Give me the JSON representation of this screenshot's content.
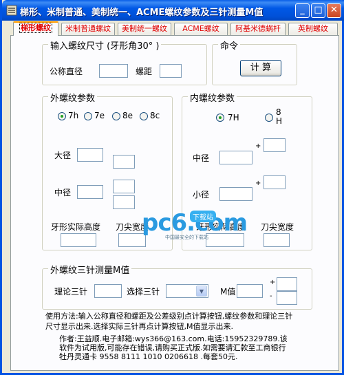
{
  "window": {
    "title": "梯形、米制普通、美制统一、ACME螺纹参数及三针测量M值",
    "minimize": "_",
    "maximize": "□",
    "close": "✕"
  },
  "tabs": [
    "梯形螺纹",
    "米制普通螺纹",
    "美制统一螺纹",
    "ACME螺纹",
    "阿基米德蜗杆",
    "英制螺纹"
  ],
  "input_group": {
    "legend": "输入螺纹尺寸 (牙形角30° )",
    "diameter_label": "公称直径",
    "pitch_label": "螺距"
  },
  "command_group": {
    "legend": "命令",
    "calc_label": "计 算"
  },
  "external": {
    "legend": "外螺纹参数",
    "options": [
      "7h",
      "7e",
      "8e",
      "8c"
    ],
    "selected": "7h",
    "major_label": "大径",
    "pitch_dia_label": "中径",
    "thread_height_label": "牙形实际高度",
    "tip_width_label": "刀尖宽度"
  },
  "internal": {
    "legend": "内螺纹参数",
    "options": [
      "7H",
      "8\nH"
    ],
    "selected": "7H",
    "pitch_dia_label": "中径",
    "minor_label": "小径",
    "plus_sign": "+",
    "thread_height_label": "牙形实际高度",
    "tip_width_label": "刀尖宽度"
  },
  "three_wire": {
    "legend": "外螺纹三针测量M值",
    "theory_label": "理论三针",
    "select_label": "选择三针",
    "m_label": "M值",
    "plus": "+",
    "minus": "-"
  },
  "notes": "使用方法:输入公称直径和螺距及公差级别点计算按钮,螺纹参数和理论三针尺寸显示出来.选择实际三针再点计算按钮,M值显示出来.",
  "author": "作者:王益顺.电子邮箱:wys366@163.com.电话:15952329789.该软件为试用版,可能存在错误,请购买正式版.如需要请汇款至工商银行牡丹灵通卡 9558 8111 1010 0206618 .每套50元.",
  "watermark": {
    "logo": "pc6.com",
    "badge": "下载站",
    "slogan": "中国最安全的下载站"
  }
}
